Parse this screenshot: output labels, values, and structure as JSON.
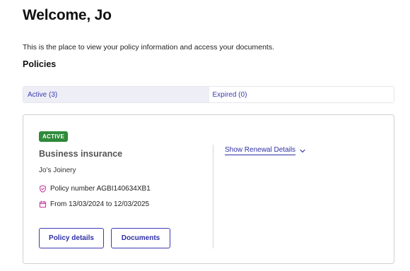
{
  "header": {
    "title": "Welcome, Jo",
    "intro": "This is the place to view your policy information and access your documents."
  },
  "policies": {
    "section_title": "Policies",
    "tabs": [
      {
        "label": "Active (3)",
        "selected": true
      },
      {
        "label": "Expired (0)",
        "selected": false
      }
    ],
    "card": {
      "status_badge": "ACTIVE",
      "product": "Business insurance",
      "business_name": "Jo's Joinery",
      "policy_number": "Policy number AGBI140634XB1",
      "period": "From 13/03/2024 to 12/03/2025",
      "policy_details_button": "Policy details",
      "documents_button": "Documents",
      "renewal_link": "Show Renewal Details",
      "icons": {
        "policy_number": "shield-check-icon",
        "period": "calendar-icon",
        "renewal": "chevron-down-icon"
      }
    }
  },
  "colors": {
    "accent": "#3b3bb3",
    "active_badge": "#2f8a3b",
    "active_tab_bg": "#eeeef6",
    "icon_pink": "#c2309a"
  }
}
